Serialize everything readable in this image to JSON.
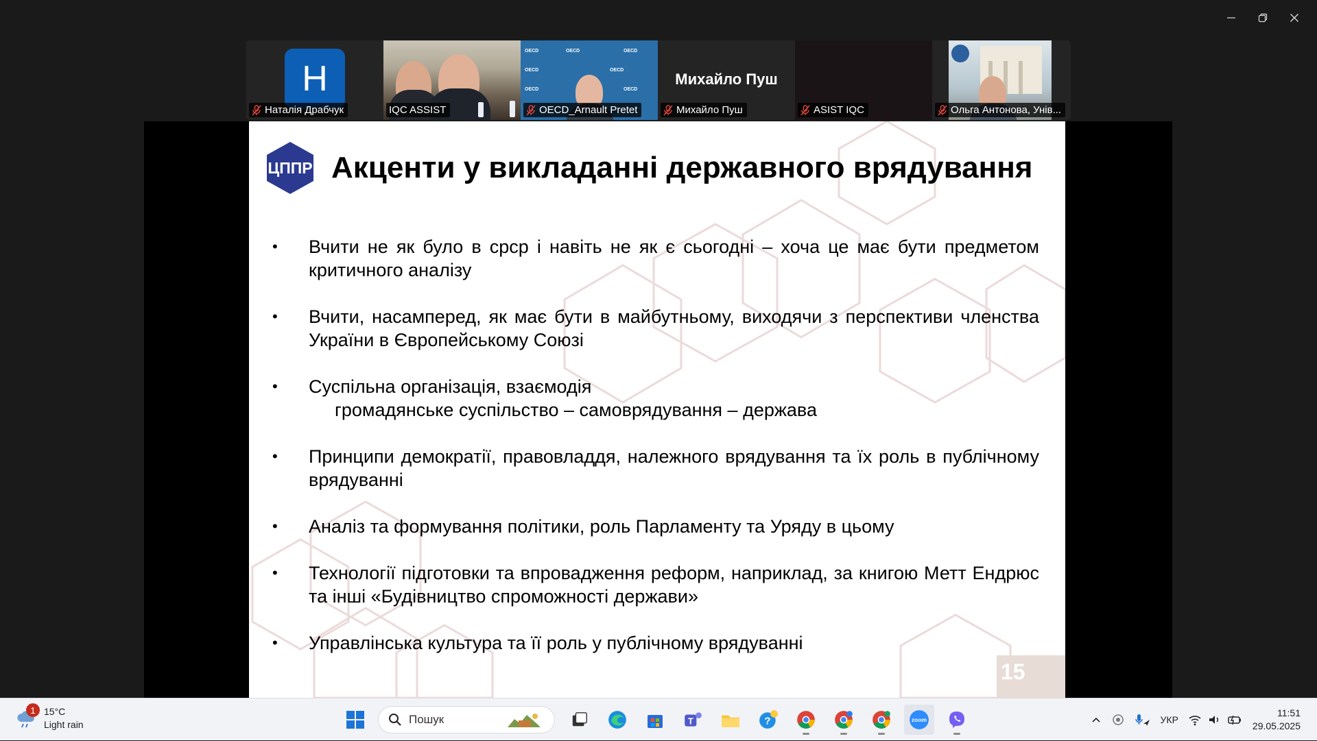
{
  "participants": [
    {
      "name": "Наталія Драбчук",
      "avatar_letter": "Н"
    },
    {
      "name": "IQC ASSIST"
    },
    {
      "name": "OECD_Arnault Pretet"
    },
    {
      "name": "Михайло Пуш",
      "display_name": "Михайло Пуш"
    },
    {
      "name": "ASIST IQC"
    },
    {
      "name": "Ольга Антонова, Унів..."
    }
  ],
  "oecd_label": "OECD",
  "slide": {
    "logo_text": "ЦППР",
    "title": "Акценти у викладанні державного врядування",
    "bullet_symbol": "•",
    "bullets": [
      {
        "text": "Вчити не як було в срср і навіть не як є сьогодні – хоча це має бути предметом критичного аналізу"
      },
      {
        "text": "Вчити, насамперед, як має бути в майбутньому, виходячи з перспективи членства України в Європейському Союзі"
      },
      {
        "text": "Суспільна організація, взаємодія",
        "sub": "громадянське суспільство – самоврядування – держава"
      },
      {
        "text": "Принципи демократії, правовладдя, належного врядування та їх роль в публічному врядуванні"
      },
      {
        "text": "Аналіз та формування політики, роль Парламенту та Уряду в цьому"
      },
      {
        "text": "Технології підготовки та впровадження реформ, наприклад, за книгою Метт Ендрюс та інші «Будівництво спроможності держави»"
      },
      {
        "text": "Управлінська культура та її роль у публічному врядуванні"
      }
    ],
    "page_number": "15"
  },
  "taskbar": {
    "weather_alert": "1",
    "temperature": "15°C",
    "condition": "Light rain",
    "search_placeholder": "Пошук",
    "language": "УКР",
    "time": "11:51",
    "date": "29.05.2025",
    "zoom_label": "zoom"
  },
  "colors": {
    "active_speaker": "#2fd27a",
    "slide_logo": "#2b3990",
    "page_num_bg": "#e8dcd6",
    "hex_line": "#e8d8d8"
  }
}
